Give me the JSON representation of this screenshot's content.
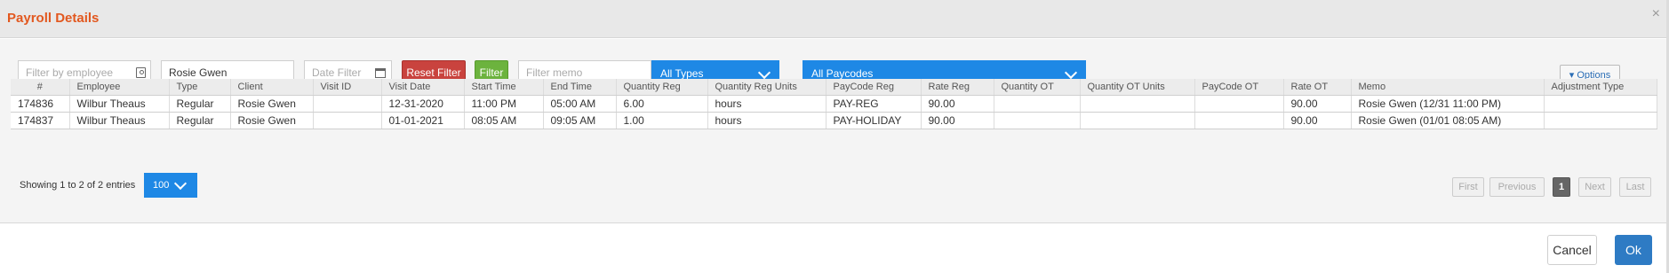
{
  "dialog": {
    "title": "Payroll Details",
    "close_glyph": "×"
  },
  "filters": {
    "employee_placeholder": "Filter by employee",
    "client_value": "Rosie Gwen",
    "date_placeholder": "Date Filter",
    "reset_label": "Reset Filter",
    "filter_label": "Filter",
    "memo_placeholder": "Filter memo",
    "types_selected": "All Types",
    "paycodes_selected": "All Paycodes",
    "options_label": "▾ Options"
  },
  "table": {
    "columns": [
      "#",
      "Employee",
      "Type",
      "Client",
      "Visit ID",
      "Visit Date",
      "Start Time",
      "End Time",
      "Quantity Reg",
      "Quantity Reg Units",
      "PayCode Reg",
      "Rate Reg",
      "Quantity OT",
      "Quantity OT Units",
      "PayCode OT",
      "Rate OT",
      "Memo",
      "Adjustment Type"
    ],
    "rows": [
      [
        "174836",
        "Wilbur Theaus",
        "Regular",
        "Rosie Gwen",
        "",
        "12-31-2020",
        "11:00 PM",
        "05:00 AM",
        "6.00",
        "hours",
        "PAY-REG",
        "90.00",
        "",
        "",
        "",
        "90.00",
        "Rosie Gwen (12/31 11:00 PM)",
        ""
      ],
      [
        "174837",
        "Wilbur Theaus",
        "Regular",
        "Rosie Gwen",
        "",
        "01-01-2021",
        "08:05 AM",
        "09:05 AM",
        "1.00",
        "hours",
        "PAY-HOLIDAY",
        "90.00",
        "",
        "",
        "",
        "90.00",
        "Rosie Gwen (01/01 08:05 AM)",
        ""
      ]
    ]
  },
  "footer": {
    "showing_text": "Showing 1 to 2 of 2 entries",
    "page_size": "100",
    "pager": {
      "first": "First",
      "previous": "Previous",
      "current": "1",
      "next": "Next",
      "last": "Last"
    }
  },
  "actions": {
    "cancel_label": "Cancel",
    "ok_label": "Ok"
  },
  "colors": {
    "title": "#e2581f",
    "primary_blue": "#1e88e5",
    "reset_red": "#c9433e",
    "filter_green": "#6cb33e",
    "ok_blue": "#2e7bc4"
  }
}
